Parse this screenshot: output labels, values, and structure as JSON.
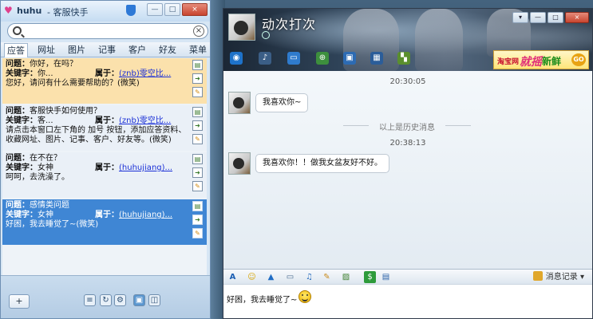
{
  "left_window": {
    "app_name": "huhu",
    "title": "- 客服快手",
    "window_buttons": {
      "min": "—",
      "max": "□",
      "close": "×"
    },
    "search": {
      "value": "",
      "placeholder": ""
    },
    "tabs": [
      "应答",
      "网址",
      "图片",
      "记事",
      "客户",
      "好友",
      "菜单"
    ],
    "active_tab": "应答",
    "items": [
      {
        "question_label": "问题：",
        "question": "你好，在吗？",
        "keyword_label": "关键字：",
        "keyword": "你...",
        "owner_label": "属于：",
        "owner": "(znb)零空比...",
        "answer": "您好，请问有什么需要帮助的？(微笑)"
      },
      {
        "question_label": "问题：",
        "question": "客服快手如何使用？",
        "keyword_label": "关键字：",
        "keyword": "客...",
        "owner_label": "属于：",
        "owner": "(znb)零空比...",
        "answer_line1": "请点击本窗口左下角的 加号 按钮，添加应答资料、",
        "answer_line2": "收藏网址、图片、记事、客户、好友等。(微笑)"
      },
      {
        "question_label": "问题：",
        "question": "在不在？",
        "keyword_label": "关键字：",
        "keyword": "女神",
        "owner_label": "属于：",
        "owner": "(huhujiang)...",
        "answer": "呵呵，去洗澡了。"
      },
      {
        "question_label": "问题：",
        "question": "感情类问题",
        "keyword_label": "关键字：",
        "keyword": "女神",
        "owner_label": "属于：",
        "owner": "(huhujiang)...",
        "answer": "好困，我去睡觉了~(微笑)"
      }
    ],
    "footer": {
      "add_label": "+"
    }
  },
  "chat_window": {
    "contact_name": "动次打次",
    "window_buttons": {
      "menu": "▾",
      "min": "—",
      "max": "□",
      "close": "×"
    },
    "ad": {
      "brand": "淘宝网",
      "shake": "就摇",
      "fresh": "新鲜",
      "go": "GO"
    },
    "messages": [
      {
        "time": "20:30:05",
        "text": "我喜欢你~"
      },
      {
        "history_divider": "以上是历史消息"
      },
      {
        "time": "20:38:13",
        "text": "我喜欢你！！做我女盆友好不好。"
      }
    ],
    "toolbar": {
      "record_label": "消息记录"
    },
    "input": {
      "value": "好困，我去睡觉了~"
    }
  }
}
